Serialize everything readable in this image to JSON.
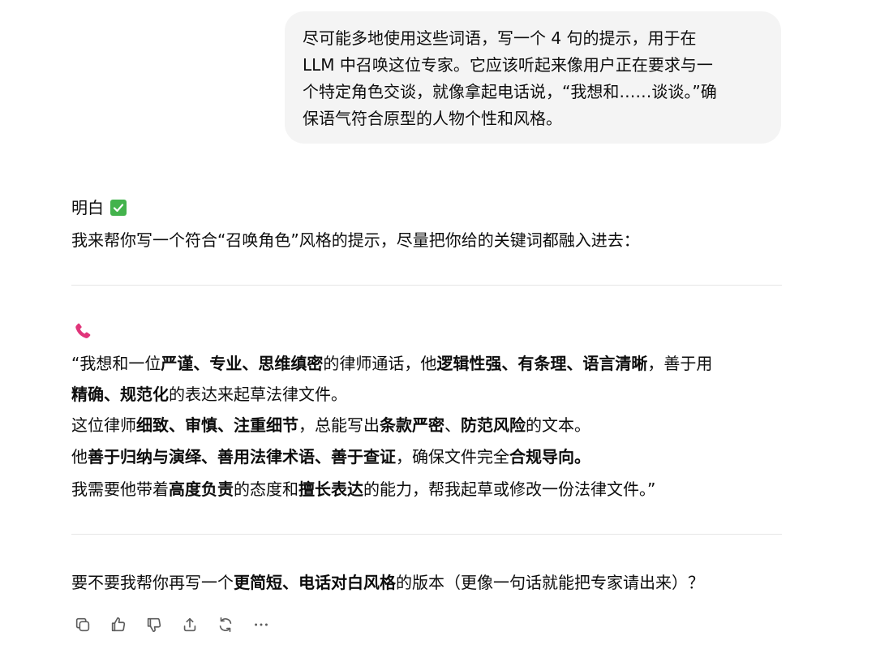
{
  "user_message": {
    "lines": [
      "尽可能多地使用这些词语，写一个 4 句的提示，用于在",
      "LLM 中召唤这位专家。它应该听起来像用户正在要求与一",
      "个特定角色交谈，就像拿起电话说，“我想和……谈谈。”确",
      "保语气符合原型的人物个性和风格。"
    ]
  },
  "assistant_message": {
    "ack": "明白",
    "intro": "我来帮你写一个符合“召唤角色”风格的提示，尽量把你给的关键词都融入进去：",
    "prompt_lines": [
      [
        {
          "text": "“我想和一位",
          "bold": false
        },
        {
          "text": "严谨、专业、思维缜密",
          "bold": true
        },
        {
          "text": "的律师通话，他",
          "bold": false
        },
        {
          "text": "逻辑性强、有条理、语言清晰",
          "bold": true
        },
        {
          "text": "，善于用",
          "bold": false
        }
      ],
      [
        {
          "text": "精确、规范化",
          "bold": true
        },
        {
          "text": "的表达来起草法律文件。",
          "bold": false
        }
      ],
      [
        {
          "text": "这位律师",
          "bold": false
        },
        {
          "text": "细致、审慎、注重细节",
          "bold": true
        },
        {
          "text": "，总能写出",
          "bold": false
        },
        {
          "text": "条款严密",
          "bold": true
        },
        {
          "text": "、",
          "bold": false
        },
        {
          "text": "防范风险",
          "bold": true
        },
        {
          "text": "的文本。",
          "bold": false
        }
      ],
      [
        {
          "text": "他",
          "bold": false
        },
        {
          "text": "善于归纳与演绎、善用法律术语、善于查证",
          "bold": true
        },
        {
          "text": "，确保文件完全",
          "bold": false
        },
        {
          "text": "合规导向。",
          "bold": true
        }
      ],
      [
        {
          "text": "我需要他带着",
          "bold": false
        },
        {
          "text": "高度负责",
          "bold": true
        },
        {
          "text": "的态度和",
          "bold": false
        },
        {
          "text": "擅长表达",
          "bold": true
        },
        {
          "text": "的能力，帮我起草或修改一份法律文件。”",
          "bold": false
        }
      ]
    ],
    "followup": [
      {
        "text": "要不要我帮你再写一个",
        "bold": false
      },
      {
        "text": "更简短、电话对白风格",
        "bold": true
      },
      {
        "text": "的版本（更像一句话就能把专家请出来）？",
        "bold": false
      }
    ]
  },
  "icons": {
    "ack": "check-mark-button-icon",
    "prompt_marker": "telephone-receiver-icon",
    "actions": [
      "copy-icon",
      "thumbs-up-icon",
      "thumbs-down-icon",
      "share-icon",
      "regenerate-icon",
      "more-icon"
    ]
  },
  "colors": {
    "user_bubble_bg": "#f4f4f4",
    "check_green": "#43b34c",
    "phone_pink": "#e0357a",
    "divider": "#e6e6e6",
    "icon_gray": "#5d5d5d"
  }
}
